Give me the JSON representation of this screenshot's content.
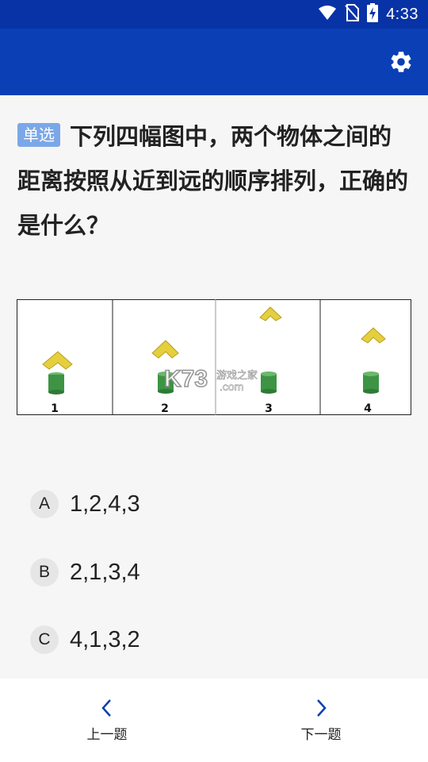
{
  "status_bar": {
    "time": "4:33",
    "icons": [
      "wifi-icon",
      "no-sim-icon",
      "battery-charging-icon"
    ]
  },
  "app_bar": {
    "settings_icon": "gear-icon",
    "background_color": "#0a3fb5"
  },
  "question": {
    "tag": "单选",
    "text": "下列四幅图中，两个物体之间的距离按照从近到远的顺序排列，正确的是什么？"
  },
  "figure": {
    "panel_labels": [
      "1",
      "2",
      "3",
      "4"
    ],
    "watermark": "K73 游戏之家 .com"
  },
  "options": [
    {
      "letter": "A",
      "text": "1,2,4,3"
    },
    {
      "letter": "B",
      "text": "2,1,3,4"
    },
    {
      "letter": "C",
      "text": "4,1,3,2"
    }
  ],
  "bottom_nav": {
    "prev_label": "上一题",
    "next_label": "下一题",
    "prev_icon": "chevron-left-icon",
    "next_icon": "chevron-right-icon",
    "accent_color": "#0a3fb5"
  }
}
